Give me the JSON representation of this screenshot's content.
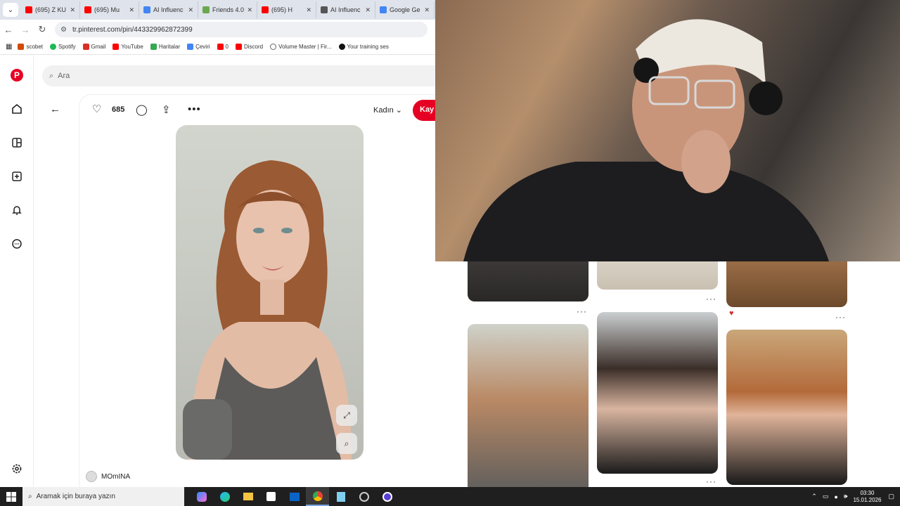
{
  "browser": {
    "tabs": [
      {
        "title": "(695) Z KU",
        "color": "#ff0000"
      },
      {
        "title": "(695) Mu",
        "color": "#ff0000"
      },
      {
        "title": "AI Influenc",
        "color": "#4285f4"
      },
      {
        "title": "Friends 4.0",
        "color": "#6aa84f"
      },
      {
        "title": "(695) H",
        "color": "#ff0000"
      },
      {
        "title": "AI Influenc",
        "color": "#555555"
      },
      {
        "title": "Google Ge",
        "color": "#4285f4"
      }
    ],
    "url": "tr.pinterest.com/pin/443329962872399",
    "bookmarks": [
      {
        "label": "scobet",
        "color": "#d04a02"
      },
      {
        "label": "Spotify",
        "color": "#1db954"
      },
      {
        "label": "Gmail",
        "color": "#d93025"
      },
      {
        "label": "YouTube",
        "color": "#ff0000"
      },
      {
        "label": "Haritalar",
        "color": "#34a853"
      },
      {
        "label": "Çeviri",
        "color": "#4285f4"
      },
      {
        "label": "0",
        "color": "#ff0000"
      },
      {
        "label": "Discord",
        "color": "#ff0000"
      },
      {
        "label": "Volume Master | Fir...",
        "color": "#666666"
      },
      {
        "label": "Your training ses",
        "color": "#111111"
      }
    ]
  },
  "pinterest": {
    "search_placeholder": "Ara",
    "likes": "685",
    "board": "Kadın",
    "save_label": "Kay",
    "author": "MOmINA"
  },
  "taskbar": {
    "search_placeholder": "Aramak için buraya yazın",
    "time": "03:30",
    "date": "15.01.2026"
  }
}
